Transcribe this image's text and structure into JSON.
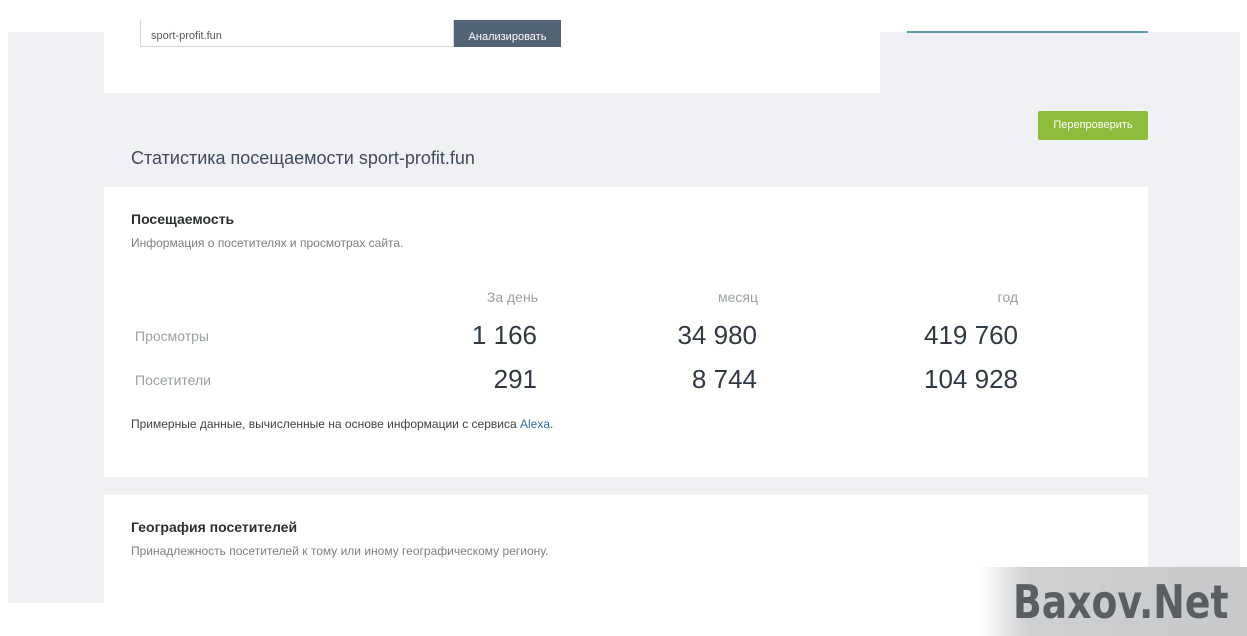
{
  "search": {
    "value": "sport-profit.fun",
    "button_label": "Анализировать"
  },
  "recheck_button_label": "Перепроверить",
  "section_title": "Статистика посещаемости sport-profit.fun",
  "traffic": {
    "heading": "Посещаемость",
    "subtitle": "Информация о посетителях и просмотрах сайта.",
    "columns": [
      "За день",
      "месяц",
      "год"
    ],
    "rows": [
      {
        "label": "Просмотры",
        "values": [
          "1 166",
          "34 980",
          "419 760"
        ]
      },
      {
        "label": "Посетители",
        "values": [
          "291",
          "8 744",
          "104 928"
        ]
      }
    ],
    "note_prefix": "Примерные данные, вычисленные на основе информации с сервиса ",
    "note_link": "Alexa",
    "note_suffix": "."
  },
  "geo": {
    "heading": "География посетителей",
    "subtitle": "Принадлежность посетителей к тому или иному географическому региону."
  },
  "watermark": "Baxov.Net",
  "colors": {
    "recheck_button": "#8cbc3a",
    "analyze_button": "#516375",
    "link": "#2e6da4",
    "background": "#f0f1f4"
  }
}
